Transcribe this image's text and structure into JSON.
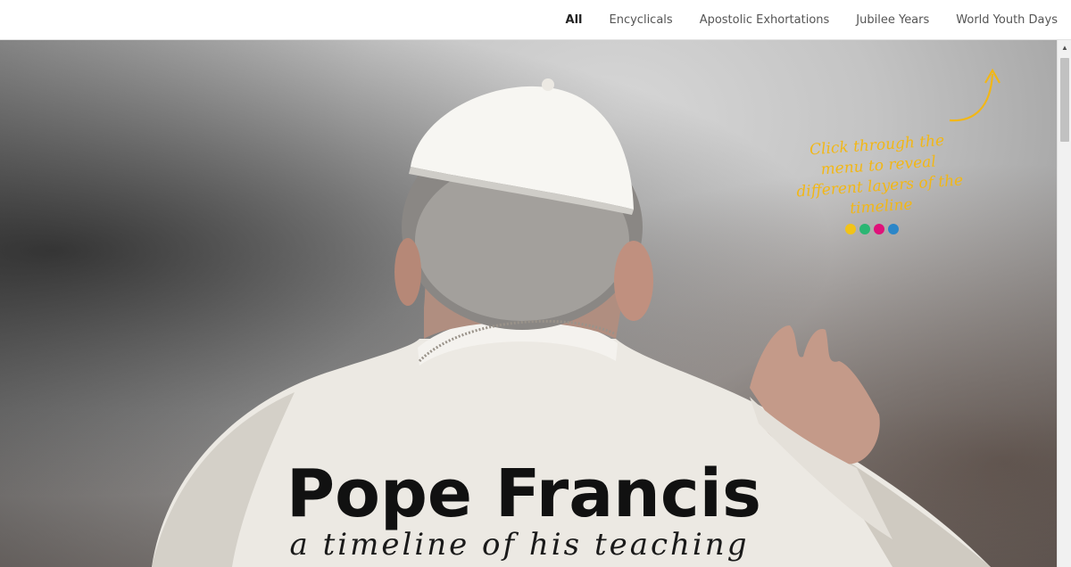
{
  "nav": {
    "items": [
      {
        "label": "All",
        "active": true
      },
      {
        "label": "Encyclicals",
        "active": false
      },
      {
        "label": "Apostolic Exhortations",
        "active": false
      },
      {
        "label": "Jubilee Years",
        "active": false
      },
      {
        "label": "World Youth Days",
        "active": false
      }
    ]
  },
  "hero": {
    "image": "pope-back-waving-photo",
    "annotation": "Click through the menu to reveal different layers of the timeline",
    "dot_colors": [
      "#f2c318",
      "#2bb673",
      "#e0117a",
      "#2b86c8"
    ],
    "title": "Pope Francis",
    "subtitle": "a timeline of his teaching"
  },
  "colors": {
    "accent_yellow": "#f2b716",
    "title_color": "#111111"
  }
}
